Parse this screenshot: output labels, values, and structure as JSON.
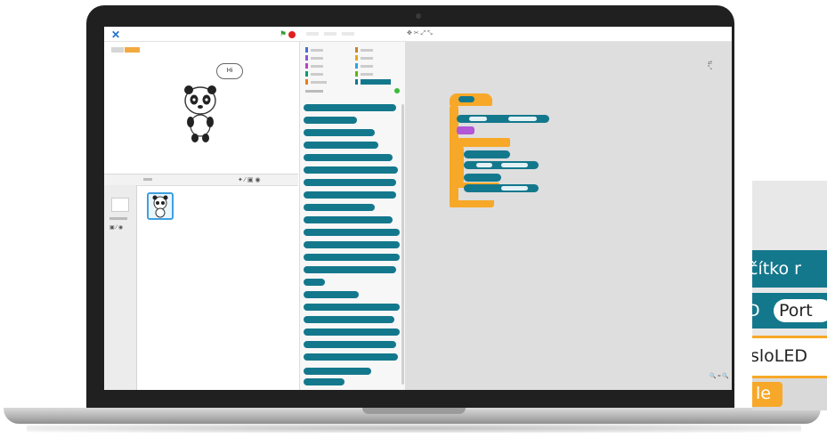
{
  "app": {
    "stage": {
      "speech_text": "Hi"
    }
  },
  "inset": {
    "line1": "čítko r",
    "line2_prefix": "D",
    "line2_pill": "Port",
    "line3": "sloLED",
    "line4": "le"
  },
  "colors": {
    "bezel": "#202020",
    "block_teal": "#14788d",
    "block_orange": "#f7a828",
    "scripts_bg": "#dedede",
    "accent_blue": "#1d6fd1"
  }
}
